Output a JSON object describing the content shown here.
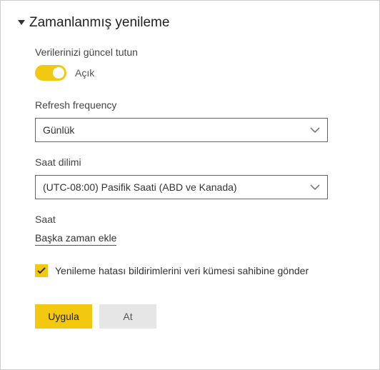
{
  "section": {
    "title": "Zamanlanmış yenileme"
  },
  "keepData": {
    "label": "Verilerinizi güncel tutun",
    "toggleState": "Açık"
  },
  "frequency": {
    "label": "Refresh frequency",
    "value": "Günlük"
  },
  "timezone": {
    "label": "Saat dilimi",
    "value": "(UTC-08:00) Pasifik Saati (ABD ve Kanada)"
  },
  "time": {
    "label": "Saat",
    "addAnother": "Başka zaman ekle"
  },
  "notify": {
    "label": "Yenileme hatası bildirimlerini veri kümesi sahibine gönder",
    "checked": true
  },
  "buttons": {
    "apply": "Uygula",
    "discard": "At"
  },
  "colors": {
    "accent": "#F2C811"
  }
}
